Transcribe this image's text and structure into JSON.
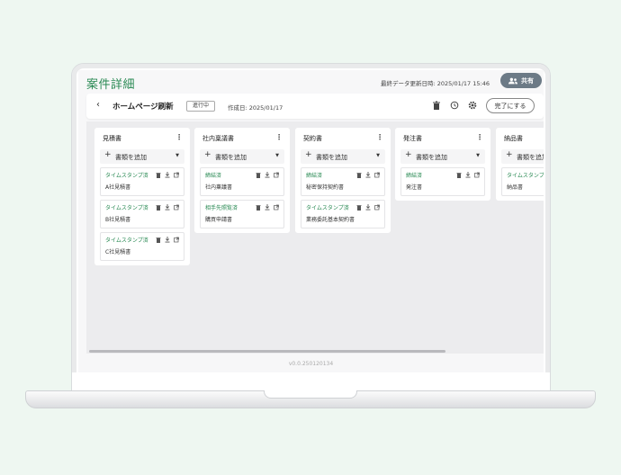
{
  "header": {
    "page_title": "案件詳細",
    "last_updated": "最終データ更新日時: 2025/01/17 15:46",
    "share_label": "共有"
  },
  "toolbar": {
    "project_name": "ホームページ刷新",
    "status": "進行中",
    "created_date": "作成日: 2025/01/17",
    "complete_label": "完了にする"
  },
  "board": {
    "add_label": "書類を追加",
    "columns": [
      {
        "title": "見積書",
        "cards": [
          {
            "status": "タイムスタンプ済",
            "name": "A社見積書"
          },
          {
            "status": "タイムスタンプ済",
            "name": "B社見積書"
          },
          {
            "status": "タイムスタンプ済",
            "name": "C社見積書"
          }
        ]
      },
      {
        "title": "社内稟議書",
        "cards": [
          {
            "status": "締結済",
            "name": "社内稟議書"
          },
          {
            "status": "相手先照覧済",
            "name": "購買申請書"
          }
        ]
      },
      {
        "title": "契約書",
        "cards": [
          {
            "status": "締結済",
            "name": "秘密保持契約書"
          },
          {
            "status": "タイムスタンプ済",
            "name": "業務委託基本契約書"
          }
        ]
      },
      {
        "title": "発注書",
        "cards": [
          {
            "status": "締結済",
            "name": "発注書"
          }
        ]
      },
      {
        "title": "納品書",
        "cards": [
          {
            "status": "タイムスタンプ済",
            "name": "納品書"
          }
        ]
      }
    ]
  },
  "footer": {
    "version": "v0.0.250120134"
  },
  "colors": {
    "accent": "#2a8a54",
    "share_bg": "#6c7a86"
  }
}
